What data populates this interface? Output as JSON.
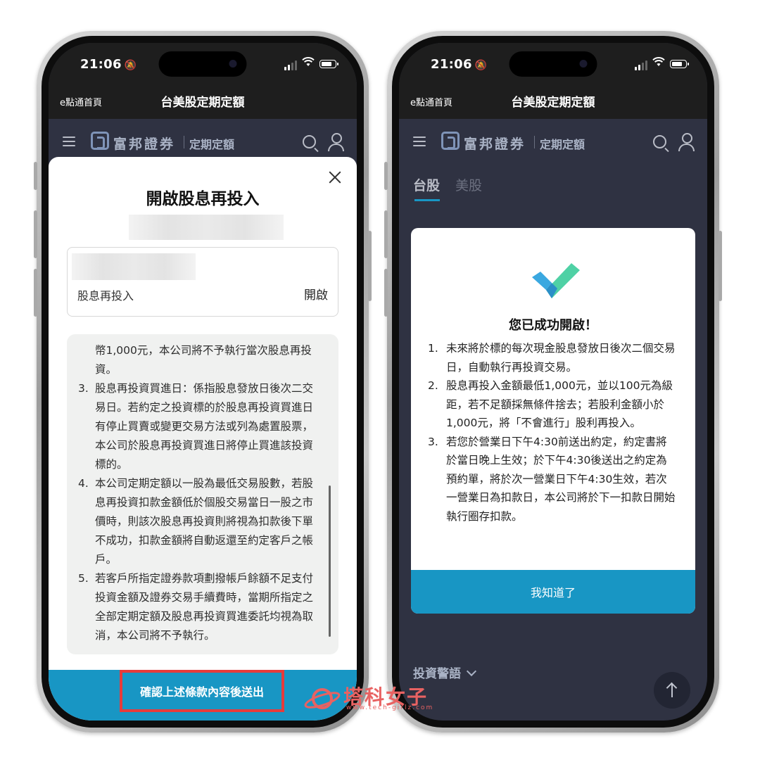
{
  "status": {
    "time": "21:06"
  },
  "nav": {
    "home": "e點通首頁",
    "title": "台美股定期定額"
  },
  "app": {
    "brand": "富邦證券",
    "section": "定期定額"
  },
  "left": {
    "modal_title": "開啟股息再投入",
    "option_label": "股息再投入",
    "option_value": "開啟",
    "terms_lead": "幣1,000元，本公司將不予執行當次股息再投資。",
    "terms": [
      {
        "num": "3.",
        "text": "股息再投資買進日：係指股息發放日後次二交易日。若約定之投資標的於股息再投資買進日有停止買賣或變更交易方法或列為處置股票，本公司於股息再投資買進日將停止買進該投資標的。"
      },
      {
        "num": "4.",
        "text": "本公司定期定額以一股為最低交易股數，若股息再投資扣款金額低於個股交易當日一股之市價時，則該次股息再投資則將視為扣款後下單不成功，扣款金額將自動返還至約定客戶之帳戶。"
      },
      {
        "num": "5.",
        "text": "若客戶所指定證券款項劃撥帳戶餘額不足支付投資金額及證券交易手續費時，當期所指定之全部定期定額及股息再投資買進委託均視為取消，本公司將不予執行。"
      }
    ],
    "confirm_button": "確認上述條款內容後送出"
  },
  "right": {
    "tabs": [
      "台股",
      "美股"
    ],
    "dialog_title": "您已成功開啟！",
    "dialog_items": [
      {
        "num": "1.",
        "text": "未來將於標的每次現金股息發放日後次二個交易日，自動執行再投資交易。"
      },
      {
        "num": "2.",
        "text": "股息再投入金額最低1,000元，並以100元為級距，若不足額採無條件捨去；若股利金額小於1,000元，將「不會進行」股利再投入。"
      },
      {
        "num": "3.",
        "text": "若您於營業日下午4:30前送出約定，約定書將於當日晚上生效；於下午4:30後送出之約定為預約單，將於次一營業日下午4:30生效，若次一營業日為扣款日，本公司將於下一扣款日開始執行圈存扣款。"
      }
    ],
    "dialog_button": "我知道了",
    "warning_label": "投資警語"
  },
  "watermark": {
    "text": "塔科女子",
    "url": "www.tech-girlz.com"
  },
  "colors": {
    "accent": "#1896c4",
    "highlight": "#e63b3b",
    "check_green": "#4fd1a5",
    "check_blue": "#3aa8e0"
  }
}
